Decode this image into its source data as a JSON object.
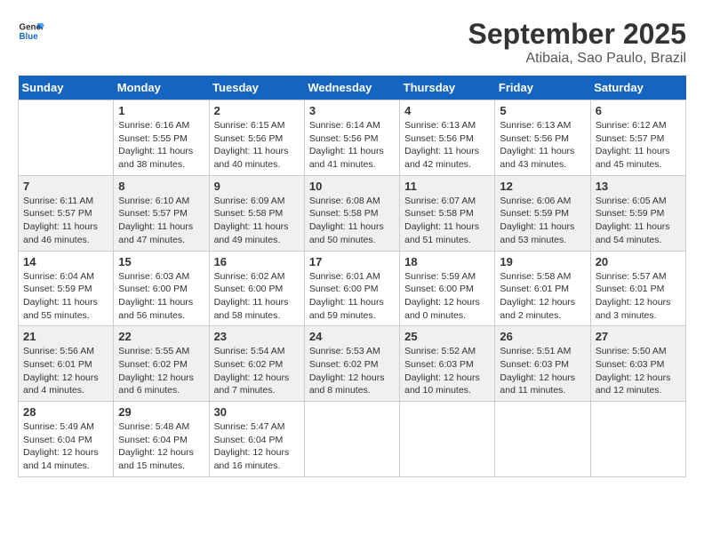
{
  "header": {
    "logo_line1": "General",
    "logo_line2": "Blue",
    "title": "September 2025",
    "subtitle": "Atibaia, Sao Paulo, Brazil"
  },
  "days_of_week": [
    "Sunday",
    "Monday",
    "Tuesday",
    "Wednesday",
    "Thursday",
    "Friday",
    "Saturday"
  ],
  "weeks": [
    [
      {
        "day": "",
        "info": ""
      },
      {
        "day": "1",
        "info": "Sunrise: 6:16 AM\nSunset: 5:55 PM\nDaylight: 11 hours\nand 38 minutes."
      },
      {
        "day": "2",
        "info": "Sunrise: 6:15 AM\nSunset: 5:56 PM\nDaylight: 11 hours\nand 40 minutes."
      },
      {
        "day": "3",
        "info": "Sunrise: 6:14 AM\nSunset: 5:56 PM\nDaylight: 11 hours\nand 41 minutes."
      },
      {
        "day": "4",
        "info": "Sunrise: 6:13 AM\nSunset: 5:56 PM\nDaylight: 11 hours\nand 42 minutes."
      },
      {
        "day": "5",
        "info": "Sunrise: 6:13 AM\nSunset: 5:56 PM\nDaylight: 11 hours\nand 43 minutes."
      },
      {
        "day": "6",
        "info": "Sunrise: 6:12 AM\nSunset: 5:57 PM\nDaylight: 11 hours\nand 45 minutes."
      }
    ],
    [
      {
        "day": "7",
        "info": "Sunrise: 6:11 AM\nSunset: 5:57 PM\nDaylight: 11 hours\nand 46 minutes."
      },
      {
        "day": "8",
        "info": "Sunrise: 6:10 AM\nSunset: 5:57 PM\nDaylight: 11 hours\nand 47 minutes."
      },
      {
        "day": "9",
        "info": "Sunrise: 6:09 AM\nSunset: 5:58 PM\nDaylight: 11 hours\nand 49 minutes."
      },
      {
        "day": "10",
        "info": "Sunrise: 6:08 AM\nSunset: 5:58 PM\nDaylight: 11 hours\nand 50 minutes."
      },
      {
        "day": "11",
        "info": "Sunrise: 6:07 AM\nSunset: 5:58 PM\nDaylight: 11 hours\nand 51 minutes."
      },
      {
        "day": "12",
        "info": "Sunrise: 6:06 AM\nSunset: 5:59 PM\nDaylight: 11 hours\nand 53 minutes."
      },
      {
        "day": "13",
        "info": "Sunrise: 6:05 AM\nSunset: 5:59 PM\nDaylight: 11 hours\nand 54 minutes."
      }
    ],
    [
      {
        "day": "14",
        "info": "Sunrise: 6:04 AM\nSunset: 5:59 PM\nDaylight: 11 hours\nand 55 minutes."
      },
      {
        "day": "15",
        "info": "Sunrise: 6:03 AM\nSunset: 6:00 PM\nDaylight: 11 hours\nand 56 minutes."
      },
      {
        "day": "16",
        "info": "Sunrise: 6:02 AM\nSunset: 6:00 PM\nDaylight: 11 hours\nand 58 minutes."
      },
      {
        "day": "17",
        "info": "Sunrise: 6:01 AM\nSunset: 6:00 PM\nDaylight: 11 hours\nand 59 minutes."
      },
      {
        "day": "18",
        "info": "Sunrise: 5:59 AM\nSunset: 6:00 PM\nDaylight: 12 hours\nand 0 minutes."
      },
      {
        "day": "19",
        "info": "Sunrise: 5:58 AM\nSunset: 6:01 PM\nDaylight: 12 hours\nand 2 minutes."
      },
      {
        "day": "20",
        "info": "Sunrise: 5:57 AM\nSunset: 6:01 PM\nDaylight: 12 hours\nand 3 minutes."
      }
    ],
    [
      {
        "day": "21",
        "info": "Sunrise: 5:56 AM\nSunset: 6:01 PM\nDaylight: 12 hours\nand 4 minutes."
      },
      {
        "day": "22",
        "info": "Sunrise: 5:55 AM\nSunset: 6:02 PM\nDaylight: 12 hours\nand 6 minutes."
      },
      {
        "day": "23",
        "info": "Sunrise: 5:54 AM\nSunset: 6:02 PM\nDaylight: 12 hours\nand 7 minutes."
      },
      {
        "day": "24",
        "info": "Sunrise: 5:53 AM\nSunset: 6:02 PM\nDaylight: 12 hours\nand 8 minutes."
      },
      {
        "day": "25",
        "info": "Sunrise: 5:52 AM\nSunset: 6:03 PM\nDaylight: 12 hours\nand 10 minutes."
      },
      {
        "day": "26",
        "info": "Sunrise: 5:51 AM\nSunset: 6:03 PM\nDaylight: 12 hours\nand 11 minutes."
      },
      {
        "day": "27",
        "info": "Sunrise: 5:50 AM\nSunset: 6:03 PM\nDaylight: 12 hours\nand 12 minutes."
      }
    ],
    [
      {
        "day": "28",
        "info": "Sunrise: 5:49 AM\nSunset: 6:04 PM\nDaylight: 12 hours\nand 14 minutes."
      },
      {
        "day": "29",
        "info": "Sunrise: 5:48 AM\nSunset: 6:04 PM\nDaylight: 12 hours\nand 15 minutes."
      },
      {
        "day": "30",
        "info": "Sunrise: 5:47 AM\nSunset: 6:04 PM\nDaylight: 12 hours\nand 16 minutes."
      },
      {
        "day": "",
        "info": ""
      },
      {
        "day": "",
        "info": ""
      },
      {
        "day": "",
        "info": ""
      },
      {
        "day": "",
        "info": ""
      }
    ]
  ]
}
